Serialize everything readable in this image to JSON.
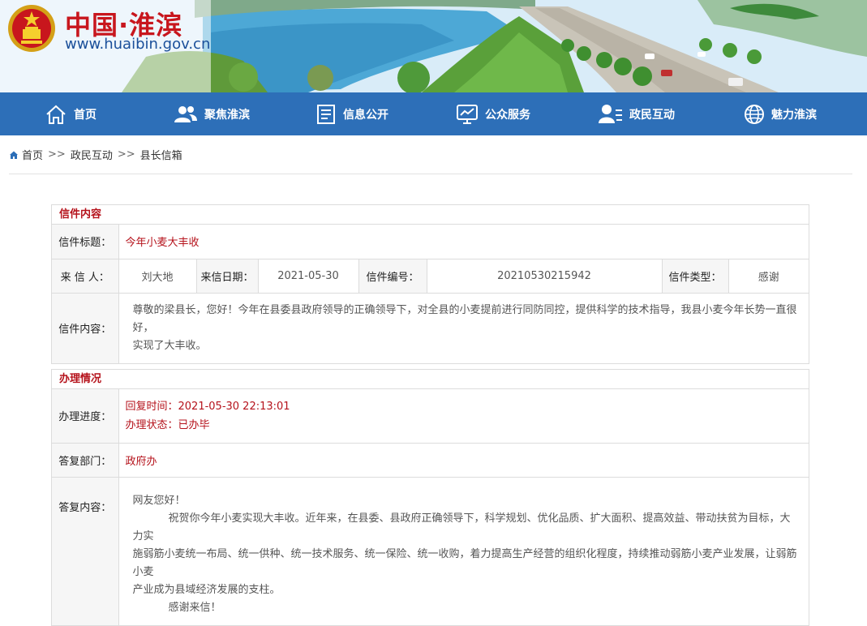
{
  "site": {
    "title": "中国·淮滨",
    "url": "www.huaibin.gov.cn"
  },
  "nav": [
    {
      "label": "首页",
      "icon": "home-icon"
    },
    {
      "label": "聚焦淮滨",
      "icon": "users-icon"
    },
    {
      "label": "信息公开",
      "icon": "document-icon"
    },
    {
      "label": "公众服务",
      "icon": "monitor-chart-icon"
    },
    {
      "label": "政民互动",
      "icon": "user-list-icon"
    },
    {
      "label": "魅力淮滨",
      "icon": "globe-icon"
    }
  ],
  "breadcrumb": {
    "items": [
      "首页",
      "政民互动",
      "县长信箱"
    ],
    "separator": ">>"
  },
  "letter": {
    "section_title": "信件内容",
    "subject_label": "信件标题：",
    "subject": "今年小麦大丰收",
    "sender_label": "来 信 人：",
    "sender": "刘大地",
    "date_label": "来信日期：",
    "date": "2021-05-30",
    "number_label": "信件编号：",
    "number": "20210530215942",
    "type_label": "信件类型：",
    "type": "感谢",
    "content_label": "信件内容：",
    "content_line1": "尊敬的梁县长，您好！今年在县委县政府领导的正确领导下，对全县的小麦提前进行同防同控，提供科学的技术指导，我县小麦今年长势一直很好，",
    "content_line2": "实现了大丰收。"
  },
  "handling": {
    "section_title": "办理情况",
    "progress_label": "办理进度：",
    "reply_time": "回复时间：2021-05-30 22:13:01",
    "status": "办理状态：已办毕",
    "dept_label": "答复部门：",
    "dept": "政府办",
    "reply_label": "答复内容：",
    "reply_greeting": "网友您好！",
    "reply_line1": "祝贺你今年小麦实现大丰收。近年来，在县委、县政府正确领导下，科学规划、优化品质、扩大面积、提高效益、带动扶贫为目标，大力实",
    "reply_line2": "施弱筋小麦统一布局、统一供种、统一技术服务、统一保险、统一收购，着力提高生产经营的组织化程度，持续推动弱筋小麦产业发展，让弱筋小麦",
    "reply_line3": "产业成为县域经济发展的支柱。",
    "reply_closing": "感谢来信！"
  },
  "colors": {
    "nav_bg": "#2d6fb8",
    "accent_red": "#b5121b",
    "label_bg": "#f6f6f6"
  }
}
